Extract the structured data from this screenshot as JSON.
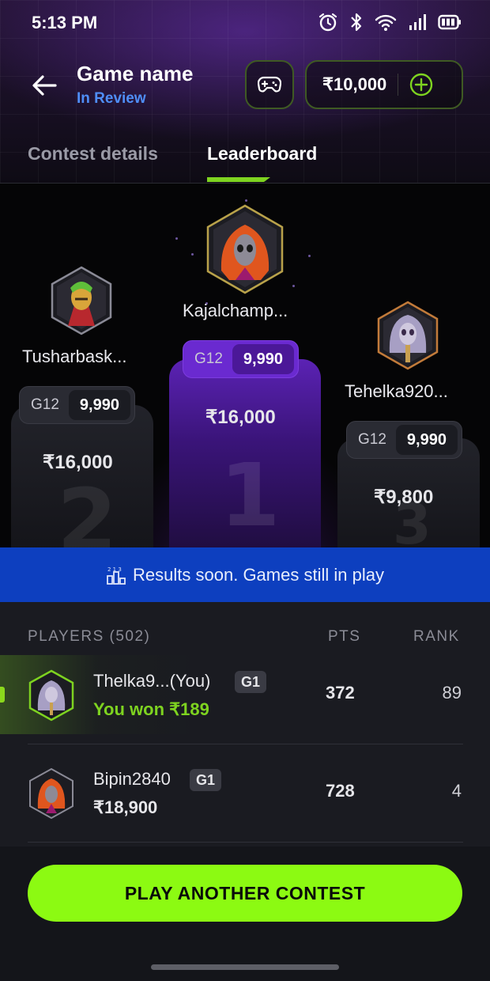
{
  "status_bar": {
    "time": "5:13 PM"
  },
  "header": {
    "title": "Game name",
    "subtitle": "In Review",
    "wallet_amount": "₹10,000"
  },
  "tabs": [
    {
      "label": "Contest details",
      "active": false
    },
    {
      "label": "Leaderboard",
      "active": true
    }
  ],
  "podium": [
    {
      "place": "1",
      "name": "Kajalchamp...",
      "tier": "G12",
      "score": "9,990",
      "prize": "₹16,000"
    },
    {
      "place": "2",
      "name": "Tusharbask...",
      "tier": "G12",
      "score": "9,990",
      "prize": "₹16,000"
    },
    {
      "place": "3",
      "name": "Tehelka920...",
      "tier": "G12",
      "score": "9,990",
      "prize": "₹9,800"
    }
  ],
  "banner": {
    "text": "Results soon. Games still in play"
  },
  "list": {
    "headers": {
      "players": "PLAYERS (502)",
      "pts": "PTS",
      "rank": "RANK"
    },
    "rows": [
      {
        "name": "Thelka9...(You)",
        "tier": "G1",
        "sub": "You won ₹189",
        "pts": "372",
        "rank": "89"
      },
      {
        "name": "Bipin2840",
        "tier": "G1",
        "sub": "₹18,900",
        "pts": "728",
        "rank": "4"
      }
    ]
  },
  "cta": {
    "label": "PLAY ANOTHER CONTEST"
  },
  "colors": {
    "accent": "#8cfa12",
    "banner": "#0d3fbf",
    "first_place": "#6a2ad0",
    "link": "#4f8ef7"
  }
}
